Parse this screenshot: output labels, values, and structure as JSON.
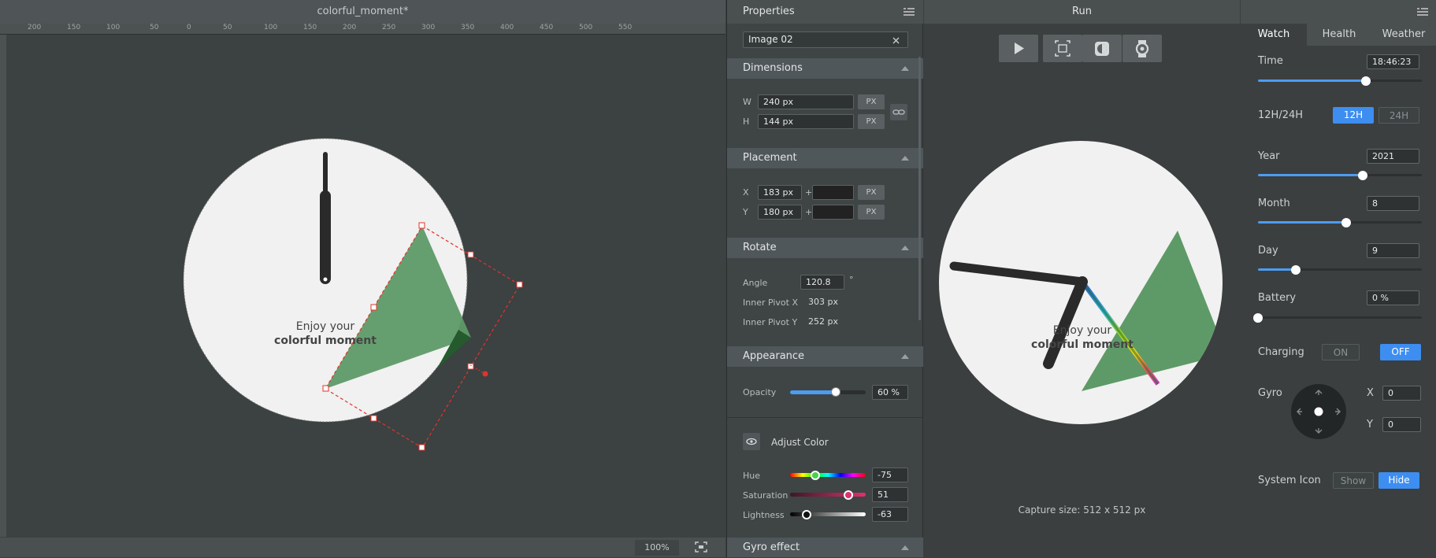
{
  "canvas": {
    "title": "colorful_moment*",
    "ruler_labels": [
      "200",
      "150",
      "100",
      "50",
      "0",
      "50",
      "100",
      "150",
      "200",
      "250",
      "300",
      "350",
      "400",
      "450",
      "500",
      "550"
    ],
    "watch_text_line1": "Enjoy your",
    "watch_text_line2": "colorful moment",
    "zoom": "100%",
    "icons": [
      "fit-screen-icon"
    ]
  },
  "properties": {
    "title": "Properties",
    "object_name": "Image 02",
    "dimensions": {
      "header": "Dimensions",
      "w_label": "W",
      "w_value": "240 px",
      "h_label": "H",
      "h_value": "144 px",
      "unit": "PX"
    },
    "placement": {
      "header": "Placement",
      "x_label": "X",
      "x_value": "183 px",
      "y_label": "Y",
      "y_value": "180 px",
      "plus": "+",
      "unit": "PX"
    },
    "rotate": {
      "header": "Rotate",
      "angle_label": "Angle",
      "angle_value": "120.8",
      "degree": "°",
      "pivot_x_label": "Inner Pivot X",
      "pivot_x_value": "303 px",
      "pivot_y_label": "Inner Pivot Y",
      "pivot_y_value": "252 px"
    },
    "appearance": {
      "header": "Appearance",
      "opacity_label": "Opacity",
      "opacity_value": "60 %",
      "opacity_level": 0.6
    },
    "adjust_color": {
      "label": "Adjust Color",
      "hue_label": "Hue",
      "hue_value": "-75",
      "saturation_label": "Saturation",
      "saturation_value": "51",
      "lightness_label": "Lightness",
      "lightness_value": "-63"
    },
    "gyro_effect": {
      "header": "Gyro effect"
    }
  },
  "run": {
    "title": "Run",
    "watch_text_line1": "Enjoy your",
    "watch_text_line2": "colorful moment",
    "capture_size": "Capture size: 512 x 512 px"
  },
  "settings": {
    "tabs": [
      "Watch",
      "Health",
      "Weather"
    ],
    "active_tab": "Watch",
    "time": {
      "label": "Time",
      "value": "18:46:23",
      "level": 0.66
    },
    "format": {
      "label": "12H/24H",
      "opt12": "12H",
      "opt24": "24H",
      "selected": "12H"
    },
    "year": {
      "label": "Year",
      "value": "2021",
      "level": 0.64
    },
    "month": {
      "label": "Month",
      "value": "8",
      "level": 0.54
    },
    "day": {
      "label": "Day",
      "value": "9",
      "level": 0.23
    },
    "battery": {
      "label": "Battery",
      "value": "0 %",
      "level": 0.0
    },
    "charging": {
      "label": "Charging",
      "on": "ON",
      "off": "OFF",
      "selected": "OFF"
    },
    "gyro": {
      "label": "Gyro",
      "x_label": "X",
      "x_value": "0",
      "y_label": "Y",
      "y_value": "0"
    },
    "system_icon": {
      "label": "System Icon",
      "show": "Show",
      "hide": "Hide",
      "selected": "Hide"
    }
  },
  "colors": {
    "accent": "#3d8ef0",
    "triangle": "#5e9a67",
    "panel": "#3f4445"
  }
}
